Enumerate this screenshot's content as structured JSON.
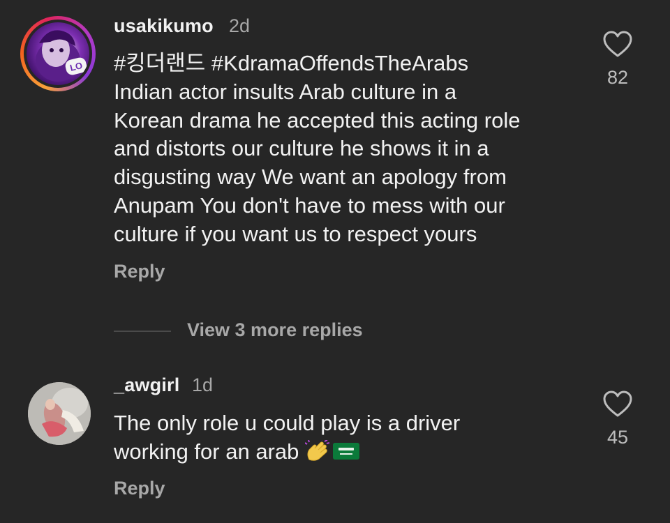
{
  "comments": [
    {
      "username": "usakikumo",
      "time": "2d",
      "hashtags": "#킹더랜드 #KdramaOffendsTheArabs",
      "body_lines": [
        "Indian actor insults Arab culture in a",
        "Korean drama  he accepted this acting role",
        "and distorts our culture he shows it in a",
        "disgusting way We want an apology from",
        "Anupam You don't have to mess with our",
        "culture if you want us to respect yours"
      ],
      "reply_label": "Reply",
      "likes": "82",
      "avatar_badge": "LO"
    },
    {
      "username": "_awgirl",
      "time": "1d",
      "body_lines": [
        "The only role u could play is a driver",
        "working for an arab"
      ],
      "emojis": [
        "waving-hand-emoji",
        "saudi-arabia-flag-emoji"
      ],
      "reply_label": "Reply",
      "likes": "45"
    }
  ],
  "view_more_replies": "View 3 more replies",
  "colors": {
    "background": "#262626",
    "primary_text": "#f2f2f2",
    "secondary_text": "#a8a8a8",
    "ring_gradient": [
      "#f9a23a",
      "#e0245c",
      "#8a3ad8"
    ]
  }
}
